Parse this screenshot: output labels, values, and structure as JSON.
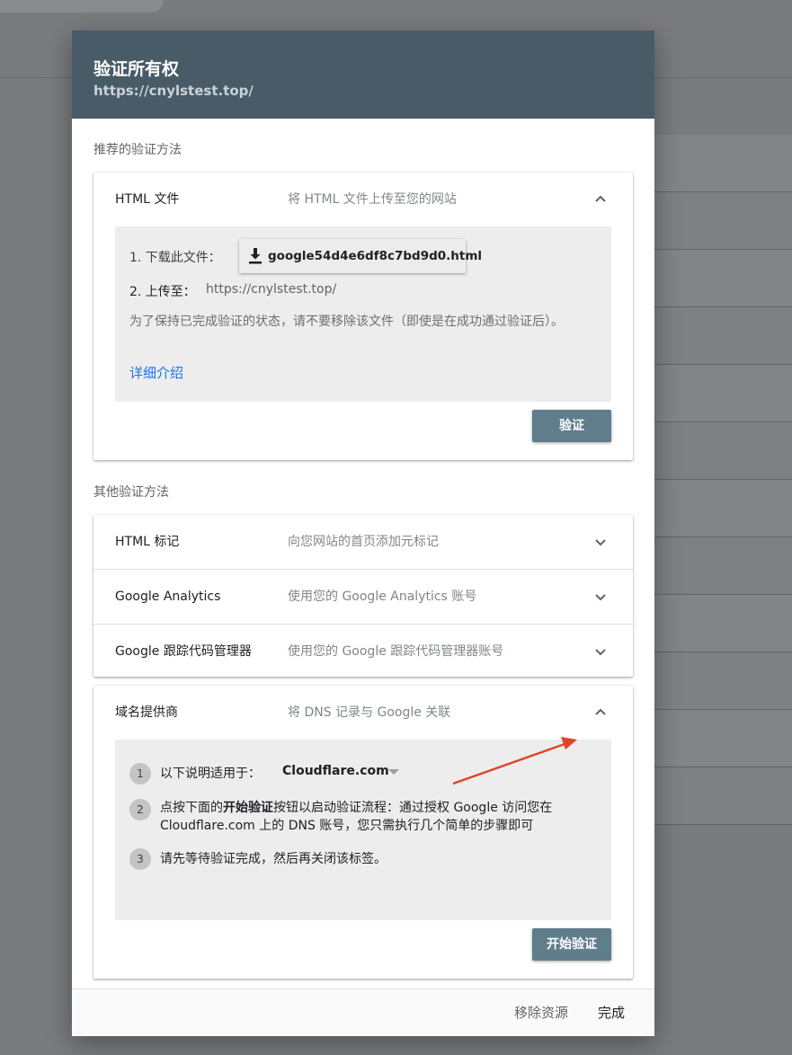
{
  "dialog": {
    "title": "验证所有权",
    "url": "https://cnylstest.top/"
  },
  "recommended": {
    "section_label": "推荐的验证方法",
    "method_title": "HTML 文件",
    "method_desc": "将 HTML 文件上传至您的网站",
    "step1_label": "1. 下载此文件：",
    "download_filename": "google54d4e6df8c7bd9d0.html",
    "step2_label": "2. 上传至：",
    "step2_url": "https://cnylstest.top/",
    "note": "为了保持已完成验证的状态，请不要移除该文件（即使是在成功通过验证后）。",
    "details_link": "详细介绍",
    "verify_button": "验证"
  },
  "other": {
    "section_label": "其他验证方法",
    "methods": [
      {
        "title": "HTML 标记",
        "desc": "向您网站的首页添加元标记"
      },
      {
        "title": "Google Analytics",
        "desc": "使用您的 Google Analytics 账号"
      },
      {
        "title": "Google 跟踪代码管理器",
        "desc": "使用您的 Google 跟踪代码管理器账号"
      }
    ]
  },
  "domain_provider": {
    "title": "域名提供商",
    "desc": "将 DNS 记录与 Google 关联",
    "steps": [
      {
        "num": "1",
        "label": "以下说明适用于：",
        "provider": "Cloudflare.com"
      },
      {
        "num": "2",
        "text_before": "点按下面的",
        "bold": "开始验证",
        "text_after": "按钮以启动验证流程：通过授权 Google 访问您在",
        "line2": "Cloudflare.com 上的 DNS 账号，您只需执行几个简单的步骤即可"
      },
      {
        "num": "3",
        "text": "请先等待验证完成，然后再关闭该标签。"
      }
    ],
    "start_button": "开始验证"
  },
  "footer": {
    "remove_button": "移除资源",
    "done_button": "完成"
  },
  "colors": {
    "header_bg": "#485b67",
    "primary_button": "#607d8b",
    "link": "#1a73e8",
    "annotation_arrow": "#e0442b"
  },
  "icons": {
    "expand": "chevron-down-icon",
    "collapse": "chevron-up-icon",
    "download": "download-icon",
    "dropdown": "dropdown-arrow-icon"
  }
}
